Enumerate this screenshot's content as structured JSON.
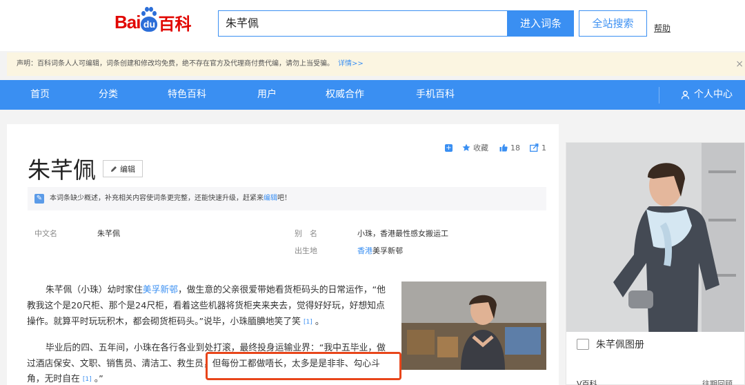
{
  "header": {
    "logo": {
      "bai": "Bai",
      "du": "du",
      "baike": "百科"
    },
    "search_value": "朱芊佩",
    "enter_button": "进入词条",
    "site_search_button": "全站搜索",
    "help_link": "帮助"
  },
  "notice": {
    "text": "声明：百科词条人人可编辑，词条创建和修改均免费，绝不存在官方及代理商付费代编，请勿上当受骗。",
    "detail": "详情>>",
    "close": "×"
  },
  "nav": {
    "items": [
      "首页",
      "分类",
      "特色百科",
      "用户",
      "权威合作",
      "手机百科"
    ],
    "user_center": "个人中心"
  },
  "tools": {
    "collect": "收藏",
    "likes": "18",
    "shares": "1"
  },
  "article": {
    "title": "朱芊佩",
    "edit_label": "编辑",
    "tip_text": "本词条缺少概述，补充相关内容使词条更完整，还能快速升级，赶紧来",
    "tip_link": "编辑",
    "tip_end": "吧！",
    "info": {
      "chinese_name_key": "中文名",
      "chinese_name_val": "朱芊佩",
      "alias_key": "别　名",
      "alias_val": "小珠，香港最性感女搬运工",
      "birthplace_key": "出生地",
      "birthplace_link": "香港",
      "birthplace_rest": "美孚新邨"
    },
    "p1": {
      "l1a": "朱芊佩（小珠）幼时家住",
      "l1link": "美孚新邨",
      "l1b": "，做生意的父亲很爱带她看货柜码头的日常运作，“他",
      "l2": "教我这个是20尺柜、那个是24尺柜，看着这些机器将货柜夹来夹去，觉得好好玩，好想知点",
      "l3": "操作。就算平时玩玩积木，都会砌货柜码头。”说毕，小珠腼腆地笑了笑",
      "ref": "[1]",
      "end": "。"
    },
    "p2": {
      "l1": "毕业后的四、五年间，小珠在各行各业到处打滚，最终投身运输业界：“我中五毕业，做",
      "l2a": "过酒店保安、文职、销售员、清洁工、救生员",
      "l2b": "，但每份工都做唔长，太多是是非非、勾心斗",
      "l3": "角，无时自在",
      "ref": "[1]",
      "end": "。”"
    }
  },
  "side": {
    "gallery_label": "朱芊佩图册",
    "bottom_left": "V百科",
    "bottom_right": "往期回顾"
  },
  "colors": {
    "brand_blue": "#3a8ff2",
    "logo_red": "#e10601",
    "highlight_red": "#e8451a",
    "notice_bg": "#fbf5e1"
  }
}
